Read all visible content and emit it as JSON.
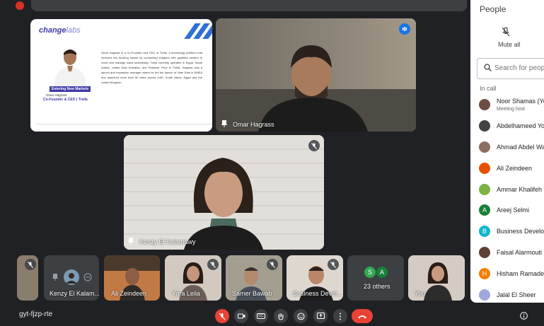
{
  "meeting": {
    "title": "",
    "code": "gyt-fjzp-rte"
  },
  "tiles": {
    "presentation": {
      "brand_a": "change",
      "brand_b": "labs",
      "role_box": "Entering New Markets",
      "person_name": "Omar Hagrass",
      "person_title": "Co-Founder & CEO | Trella",
      "bio": "Omar Hagrass is a Co-Founder and CEO of Trella, a technology platform that removes the trucking hassle by connecting shippers with qualified carriers to move and manage loads seamlessly. Trella currently operates in Egypt, Saudi Arabia, United Arab Emirates, and Pakistan. Prior to Trella, Hagrass was a launch and expansion manager where he led the launch of Uber Eats in EMEA and launched more than 50 cities across UAE, South Africa, Egypt and the United Kingdom."
    },
    "omar": {
      "name": "Omar Hagrass"
    },
    "kenzy": {
      "name": "Kenzy El Kalamawy"
    }
  },
  "filmstrip": [
    {
      "name": ""
    },
    {
      "name": "Kenzy El Kalam..."
    },
    {
      "name": "Ali Zeindeen"
    },
    {
      "name": "Yara Leila"
    },
    {
      "name": "Samer Bawab"
    },
    {
      "name": "Business Devel..."
    },
    {
      "name": "23 others",
      "avatars": [
        "S",
        "A"
      ]
    },
    {
      "name": "You"
    }
  ],
  "panel": {
    "title": "People",
    "mute_all": "Mute all",
    "search_placeholder": "Search for peop",
    "section": "In call",
    "people": [
      {
        "name": "Noor Shamas (Yo",
        "sub": "Meeting host",
        "initial": "",
        "color": "#6d4c41"
      },
      {
        "name": "Abdelhameed Yo",
        "sub": "",
        "initial": "",
        "color": "#424242"
      },
      {
        "name": "Ahmad Abdel Wa",
        "sub": "",
        "initial": "",
        "color": "#8d6e63"
      },
      {
        "name": "Ali Zeindeen",
        "sub": "",
        "initial": "",
        "color": "#e65100"
      },
      {
        "name": "Ammar Khalifeh",
        "sub": "",
        "initial": "",
        "color": "#7cb342"
      },
      {
        "name": "Areej Selmi",
        "sub": "",
        "initial": "A",
        "color": "#188038"
      },
      {
        "name": "Business Develop",
        "sub": "",
        "initial": "B",
        "color": "#12b5cb"
      },
      {
        "name": "Faisal Alarmouti",
        "sub": "",
        "initial": "",
        "color": "#5d4037"
      },
      {
        "name": "Hisham Ramader",
        "sub": "",
        "initial": "H",
        "color": "#f57c00"
      },
      {
        "name": "Jalal El Sheer",
        "sub": "",
        "initial": "",
        "color": "#9fa8da"
      }
    ]
  },
  "controls": {
    "mic": "mic-off-icon",
    "camera": "camera-icon",
    "captions_label": "CC",
    "raise_hand": "hand-icon",
    "emoji": "emoji-icon",
    "present": "present-icon",
    "more": "more-icon",
    "end_call": "end-call-icon",
    "info": "info-icon"
  },
  "colors": {
    "background": "#202124",
    "tile": "#3c4043",
    "active_speaker": "#8ab4f8",
    "danger": "#ea4335",
    "presentation_accent": "#3f3aa8"
  }
}
